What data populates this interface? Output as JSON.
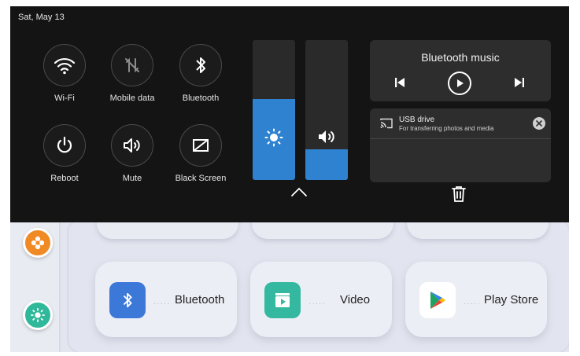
{
  "status_bar": {
    "date": "Sat, May 13"
  },
  "quick_toggles": [
    {
      "id": "wifi",
      "label": "Wi-Fi",
      "icon": "wifi-icon"
    },
    {
      "id": "mobile_data",
      "label": "Mobile data",
      "icon": "mobile-data-off-icon"
    },
    {
      "id": "bluetooth",
      "label": "Bluetooth",
      "icon": "bluetooth-icon"
    },
    {
      "id": "reboot",
      "label": "Reboot",
      "icon": "power-icon"
    },
    {
      "id": "mute",
      "label": "Mute",
      "icon": "speaker-icon"
    },
    {
      "id": "black_screen",
      "label": "Black Screen",
      "icon": "screen-off-icon"
    }
  ],
  "sliders": {
    "brightness": {
      "icon": "sun-icon",
      "level": 0.58
    },
    "volume": {
      "icon": "volume-icon",
      "level": 0.22
    }
  },
  "media_card": {
    "title": "Bluetooth music",
    "controls": [
      "previous-icon",
      "play-icon",
      "next-icon"
    ]
  },
  "notification": {
    "title": "USB drive",
    "description": "For transferring photos and media",
    "icon": "usb-cast-icon"
  },
  "home_apps": [
    {
      "label": "Bluetooth",
      "icon": "bluetooth-icon",
      "color": "#3b78d8"
    },
    {
      "label": "Video",
      "icon": "video-icon",
      "color": "#34b8a0"
    },
    {
      "label": "Play Store",
      "icon": "play-store-icon",
      "color": "#ffffff"
    }
  ],
  "colors": {
    "accent": "#2f82cf",
    "panel": "#141414",
    "card": "#2d2d2d"
  }
}
